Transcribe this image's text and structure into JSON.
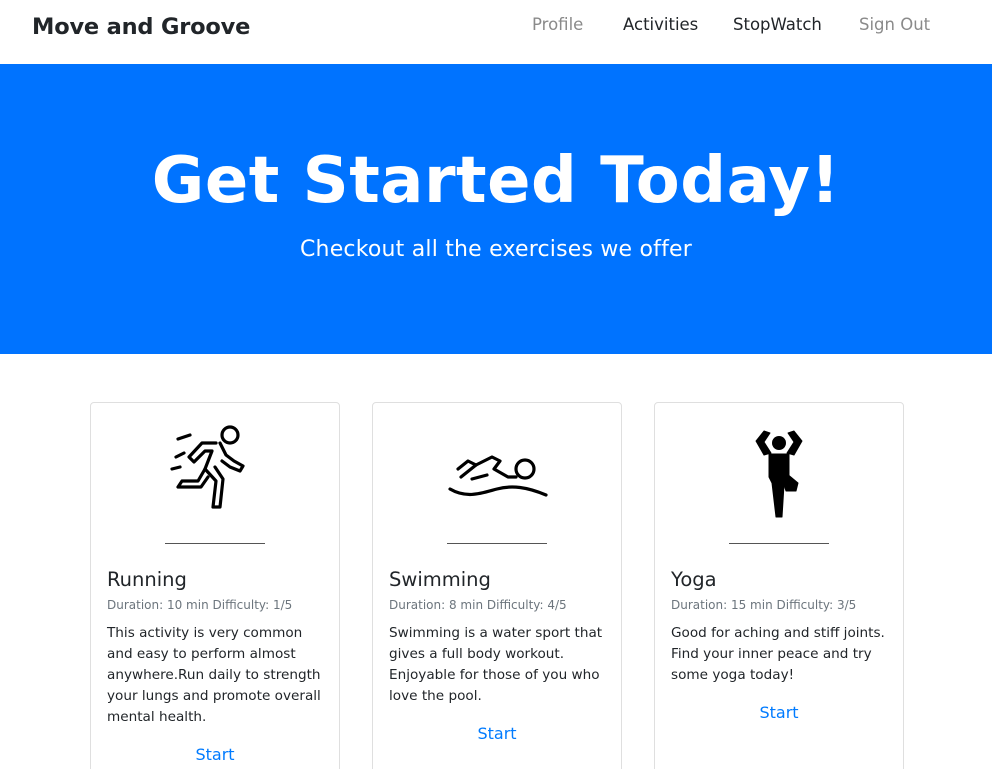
{
  "brand": "Move and Groove",
  "nav": [
    {
      "label": "Profile"
    },
    {
      "label": "Activities"
    },
    {
      "label": "StopWatch"
    },
    {
      "label": "Sign Out"
    }
  ],
  "hero": {
    "title": "Get Started Today!",
    "subtitle": "Checkout all the exercises we offer"
  },
  "cards": [
    {
      "icon": "running-person-icon",
      "title": "Running",
      "meta": "Duration: 10 min Difficulty: 1/5",
      "description": "This activity is very common and easy to perform almost anywhere.Run daily to strength your lungs and promote overall mental health.",
      "action": "Start"
    },
    {
      "icon": "swimmer-icon",
      "title": "Swimming",
      "meta": "Duration: 8 min Difficulty: 4/5",
      "description": "Swimming is a water sport that gives a full body workout. Enjoyable for those of you who love the pool.",
      "action": "Start"
    },
    {
      "icon": "yoga-pose-icon",
      "title": "Yoga",
      "meta": "Duration: 15 min Difficulty: 3/5",
      "description": "Good for aching and stiff joints. Find your inner peace and try some yoga today!",
      "action": "Start"
    }
  ],
  "colors": {
    "hero_background": "#0073ff",
    "link": "#007bff",
    "muted_nav": "#8a8a8a"
  }
}
